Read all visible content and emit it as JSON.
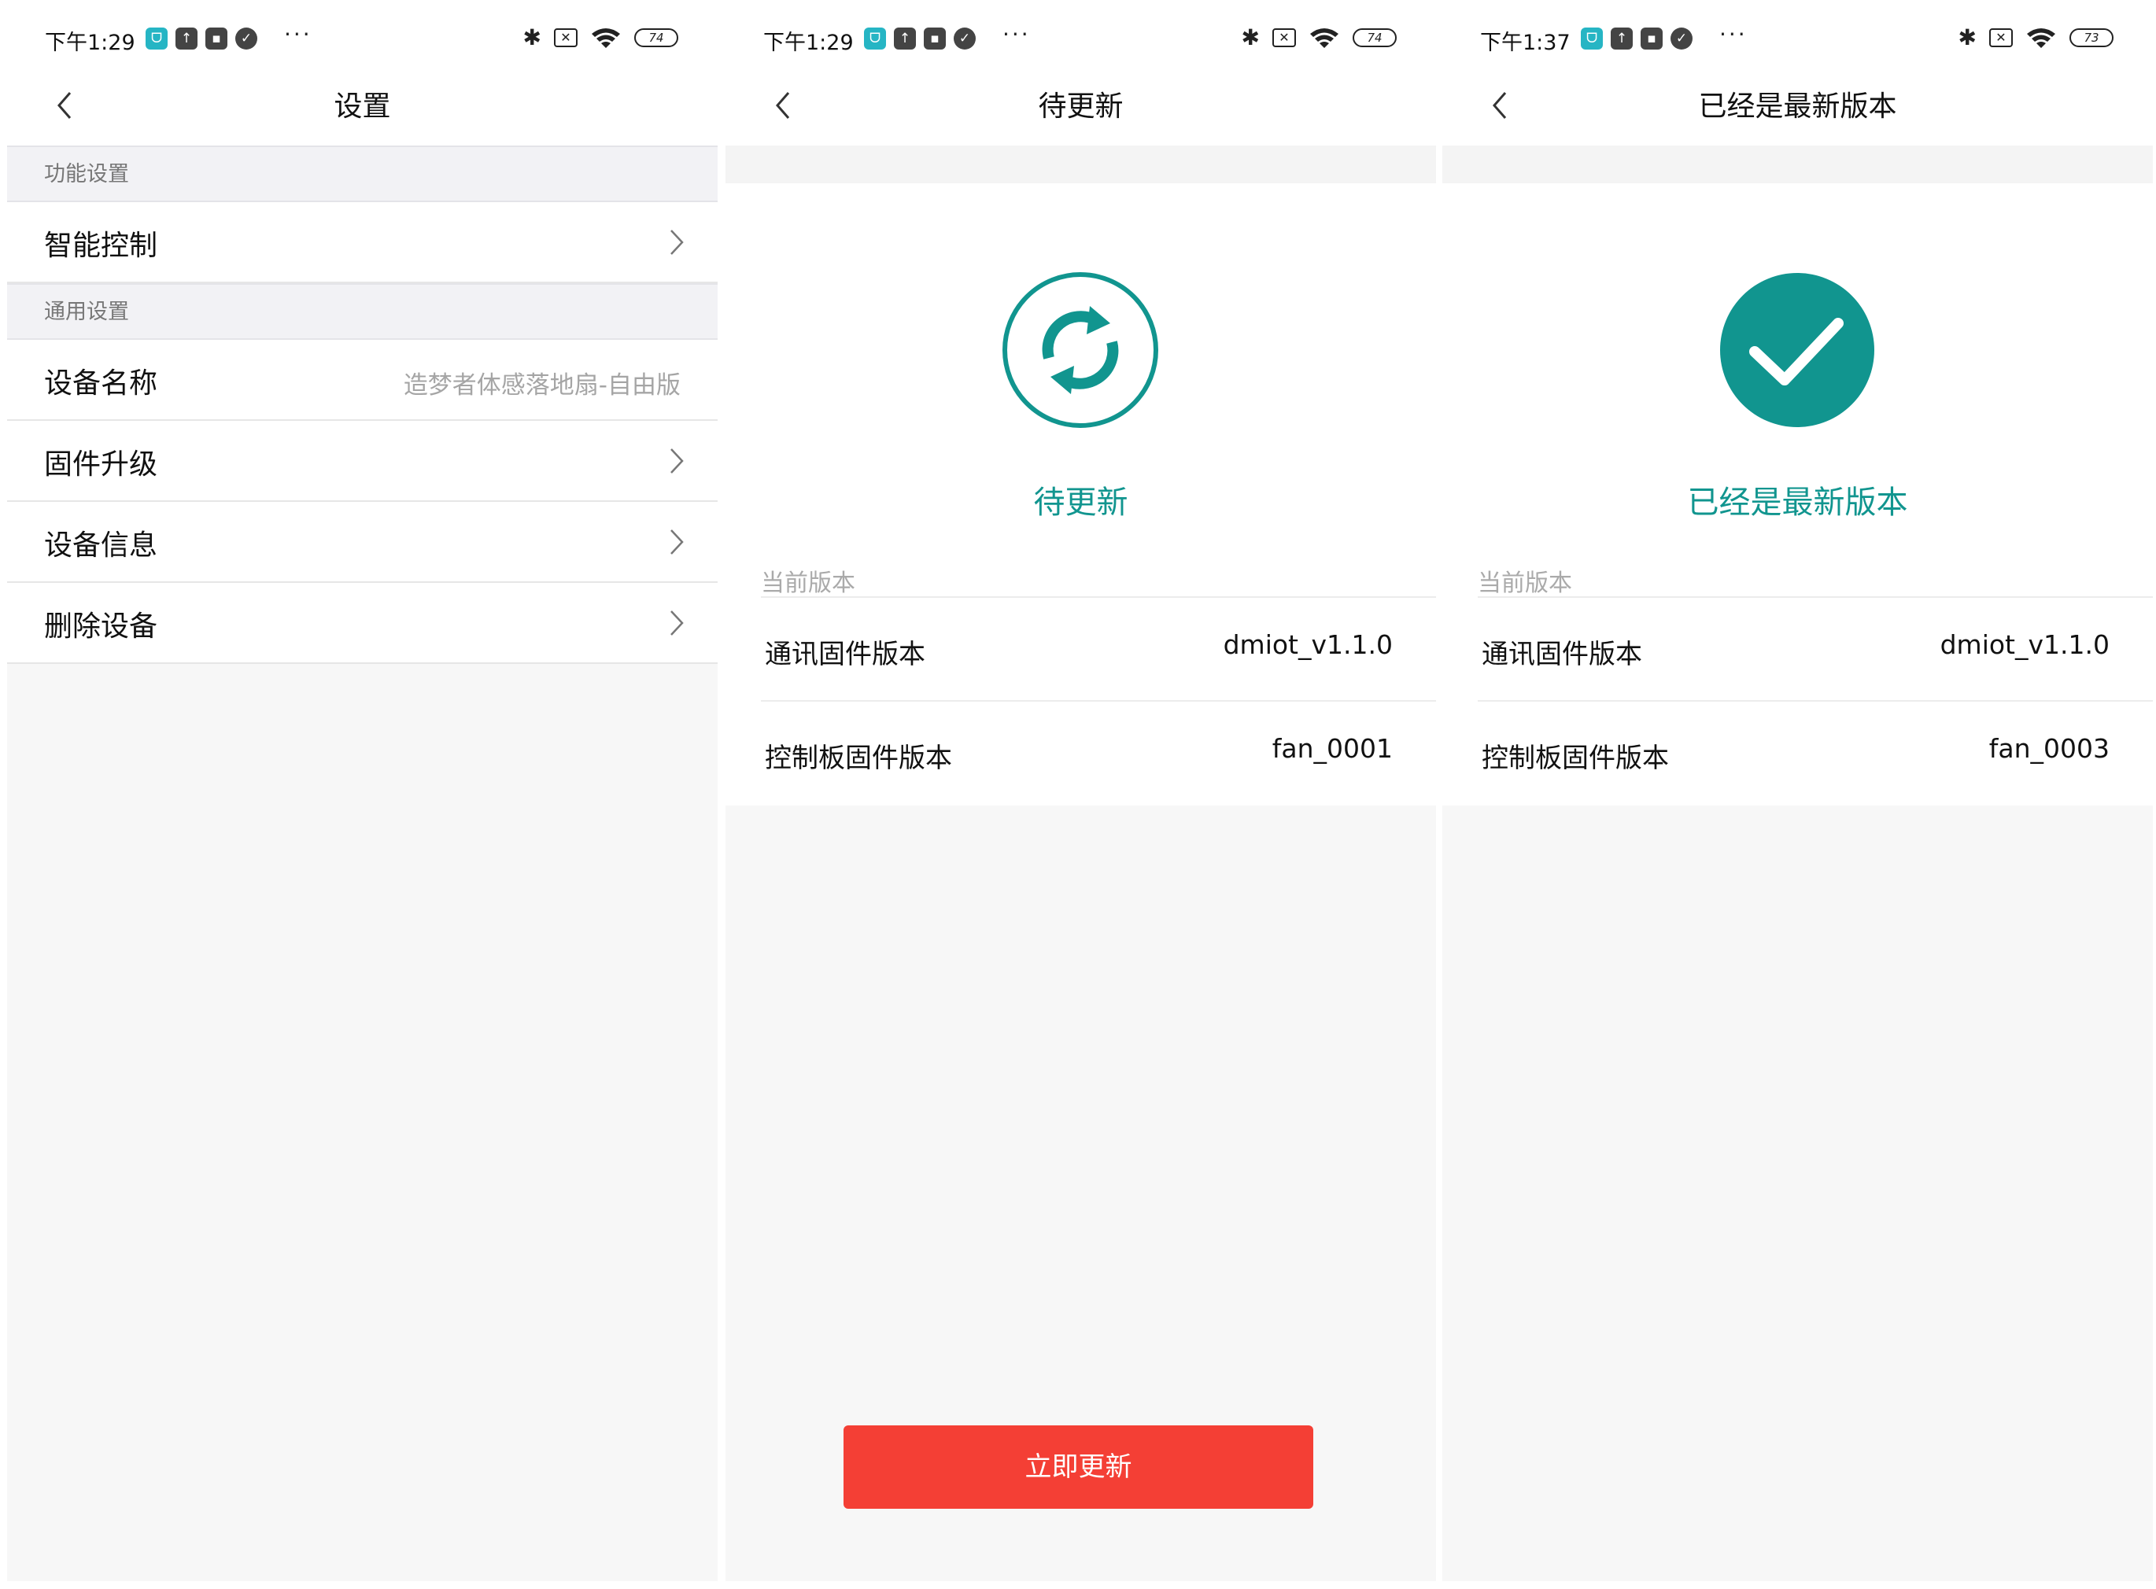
{
  "screens": {
    "settings": {
      "status_bar": {
        "time": "下午1:29",
        "battery": "74"
      },
      "title": "设置",
      "sections": [
        {
          "header": "功能设置",
          "items": [
            {
              "label": "智能控制",
              "value": ""
            }
          ]
        },
        {
          "header": "通用设置",
          "items": [
            {
              "label": "设备名称",
              "value": "造梦者体感落地扇-自由版"
            },
            {
              "label": "固件升级",
              "value": ""
            },
            {
              "label": "设备信息",
              "value": ""
            },
            {
              "label": "删除设备",
              "value": ""
            }
          ]
        }
      ]
    },
    "pending": {
      "status_bar": {
        "time": "下午1:29",
        "battery": "74"
      },
      "title": "待更新",
      "status_text": "待更新",
      "current_version_label": "当前版本",
      "versions": [
        {
          "label": "通讯固件版本",
          "value": "dmiot_v1.1.0"
        },
        {
          "label": "控制板固件版本",
          "value": "fan_0001"
        }
      ],
      "update_button": "立即更新"
    },
    "latest": {
      "status_bar": {
        "time": "下午1:37",
        "battery": "73"
      },
      "title": "已经是最新版本",
      "status_text": "已经是最新版本",
      "current_version_label": "当前版本",
      "versions": [
        {
          "label": "通讯固件版本",
          "value": "dmiot_v1.1.0"
        },
        {
          "label": "控制板固件版本",
          "value": "fan_0003"
        }
      ]
    }
  },
  "colors": {
    "accent": "#11958f",
    "danger": "#f43f35",
    "page_bg": "#f7f7f7"
  },
  "icons": [
    "back-icon",
    "chevron-right-icon",
    "refresh-icon",
    "check-icon",
    "bluetooth-icon",
    "wifi-icon",
    "battery-icon"
  ]
}
